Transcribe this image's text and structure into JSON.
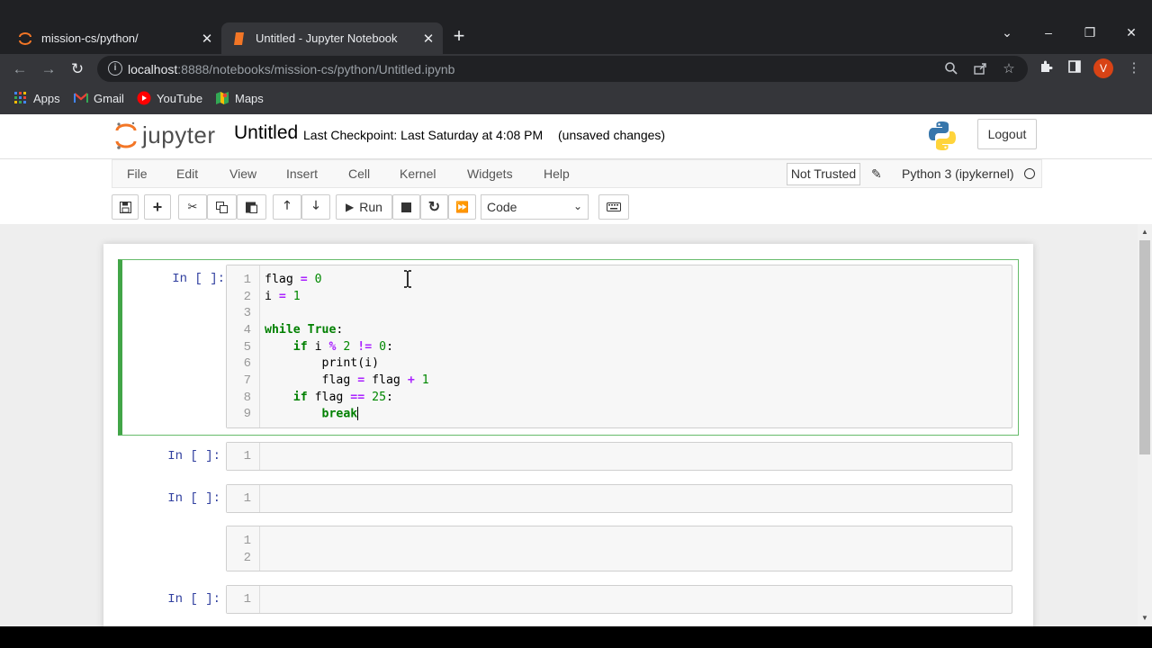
{
  "browser": {
    "tabs": [
      {
        "title": "mission-cs/python/",
        "active": false
      },
      {
        "title": "Untitled - Jupyter Notebook",
        "active": true
      }
    ],
    "url_host": "localhost",
    "url_rest": ":8888/notebooks/mission-cs/python/Untitled.ipynb",
    "avatar_letter": "V",
    "bookmarks": [
      "Apps",
      "Gmail",
      "YouTube",
      "Maps"
    ]
  },
  "jupyter": {
    "wordmark": "jupyter",
    "notebook_name": "Untitled",
    "checkpoint": "Last Checkpoint: Last Saturday at 4:08 PM",
    "unsaved": "(unsaved changes)",
    "logout": "Logout",
    "menu": [
      "File",
      "Edit",
      "View",
      "Insert",
      "Cell",
      "Kernel",
      "Widgets",
      "Help"
    ],
    "not_trusted": "Not Trusted",
    "kernel": "Python 3 (ipykernel)",
    "run_label": "Run",
    "cell_type": "Code"
  },
  "cells": [
    {
      "prompt": "In [ ]:",
      "line_numbers": [
        "1",
        "2",
        "3",
        "4",
        "5",
        "6",
        "7",
        "8",
        "9"
      ],
      "code": [
        "flag = 0",
        "i = 1",
        "",
        "while True:",
        "    if i % 2 != 0:",
        "        print(i)",
        "        flag = flag + 1",
        "    if flag == 25:",
        "        break"
      ]
    },
    {
      "prompt": "In [ ]:",
      "line_numbers": [
        "1"
      ]
    },
    {
      "prompt": "In [ ]:",
      "line_numbers": [
        "1"
      ]
    },
    {
      "prompt": "",
      "line_numbers": [
        "1",
        "2"
      ]
    },
    {
      "prompt": "In [ ]:",
      "line_numbers": [
        "1"
      ]
    }
  ],
  "colors": {
    "accent_selected": "#42a548",
    "prompt": "#303f9f",
    "keyword": "#008000",
    "operator": "#aa22ff"
  }
}
